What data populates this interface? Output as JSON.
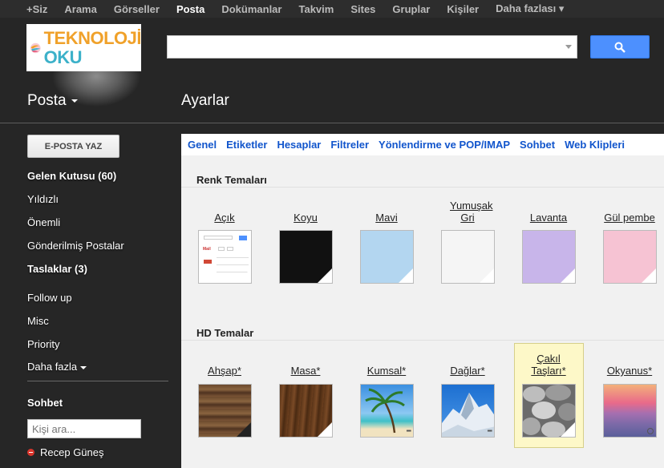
{
  "topnav": {
    "items": [
      "+Siz",
      "Arama",
      "Görseller",
      "Posta",
      "Dokümanlar",
      "Takvim",
      "Sites",
      "Gruplar",
      "Kişiler",
      "Daha fazlası ▾"
    ],
    "active_index": 3
  },
  "logo": {
    "line1": "TEKNOLOJİ",
    "line2": "OKU"
  },
  "search": {
    "value": "",
    "placeholder": ""
  },
  "header": {
    "app_menu": "Posta",
    "page_title": "Ayarlar"
  },
  "sidebar": {
    "compose_label": "E-POSTA YAZ",
    "items": [
      {
        "label": "Gelen Kutusu (60)",
        "bold": true
      },
      {
        "label": "Yıldızlı",
        "bold": false
      },
      {
        "label": "Önemli",
        "bold": false
      },
      {
        "label": "Gönderilmiş Postalar",
        "bold": false
      },
      {
        "label": "Taslaklar (3)",
        "bold": true
      },
      {
        "label": "Follow up",
        "bold": false
      },
      {
        "label": "Misc",
        "bold": false
      },
      {
        "label": "Priority",
        "bold": false
      },
      {
        "label": "Daha fazla",
        "bold": false
      }
    ]
  },
  "chat": {
    "title": "Sohbet",
    "search_placeholder": "Kişi ara...",
    "contacts": [
      {
        "name": "Recep Güneş",
        "status_color": "#d9362d"
      }
    ]
  },
  "settings": {
    "tabs": [
      "Genel",
      "Etiketler",
      "Hesaplar",
      "Filtreler",
      "Yönlendirme ve POP/IMAP",
      "Sohbet",
      "Web Klipleri"
    ],
    "color_themes_title": "Renk Temaları",
    "color_themes": [
      {
        "label": "Açık",
        "color": "#ffffff"
      },
      {
        "label": "Koyu",
        "color": "#111111"
      },
      {
        "label": "Mavi",
        "color": "#b3d6f0"
      },
      {
        "label": "Yumuşak Gri",
        "color": "#f5f5f5"
      },
      {
        "label": "Lavanta",
        "color": "#c8b5ea"
      },
      {
        "label": "Gül pembe",
        "color": "#f6c3d3"
      }
    ],
    "hd_themes_title": "HD Temalar",
    "hd_themes": [
      {
        "label": "Ahşap*",
        "icon": "wood-image"
      },
      {
        "label": "Masa*",
        "icon": "desk-image"
      },
      {
        "label": "Kumsal*",
        "icon": "beach-image"
      },
      {
        "label": "Dağlar*",
        "icon": "mountain-image"
      },
      {
        "label": "Çakıl Taşları*",
        "icon": "pebbles-image",
        "selected": true
      },
      {
        "label": "Okyanus*",
        "icon": "ocean-image"
      }
    ]
  }
}
